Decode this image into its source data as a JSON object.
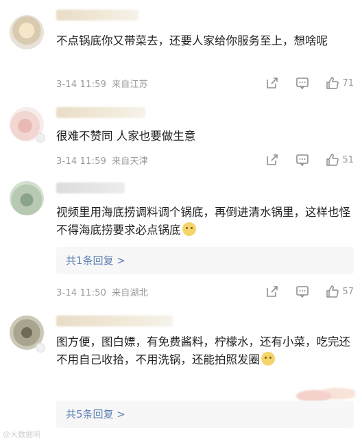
{
  "comments": [
    {
      "text": "不点锅底你又带菜去，还要人家给你服务至上，想啥呢",
      "date": "3-14 11:59",
      "location": "来自江苏",
      "likes": "71"
    },
    {
      "text": "很难不赞同 人家也要做生意",
      "date": "3-14 11:59",
      "location": "来自天津",
      "likes": "51"
    },
    {
      "text": "视频里用海底捞调料调个锅底，再倒进清水锅里，这样也怪不得海底捞要求必点锅底",
      "replies": "共1条回复 >",
      "date": "3-14 11:50",
      "location": "来自湖北",
      "likes": "57"
    },
    {
      "text": "图方便，图白嫖，有免费酱料，柠檬水，还有小菜，吃完还不用自己收拾，不用洗锅，还能拍照发圈",
      "replies": "共5条回复 >"
    }
  ],
  "watermark": "@大数据明",
  "icons": {
    "share": "share-icon",
    "comment": "comment-icon",
    "like": "thumbs-up-icon"
  },
  "colors": {
    "reply_link": "#5b7fb5",
    "meta_text": "#999999",
    "reply_box_bg": "#f7f7f7"
  }
}
